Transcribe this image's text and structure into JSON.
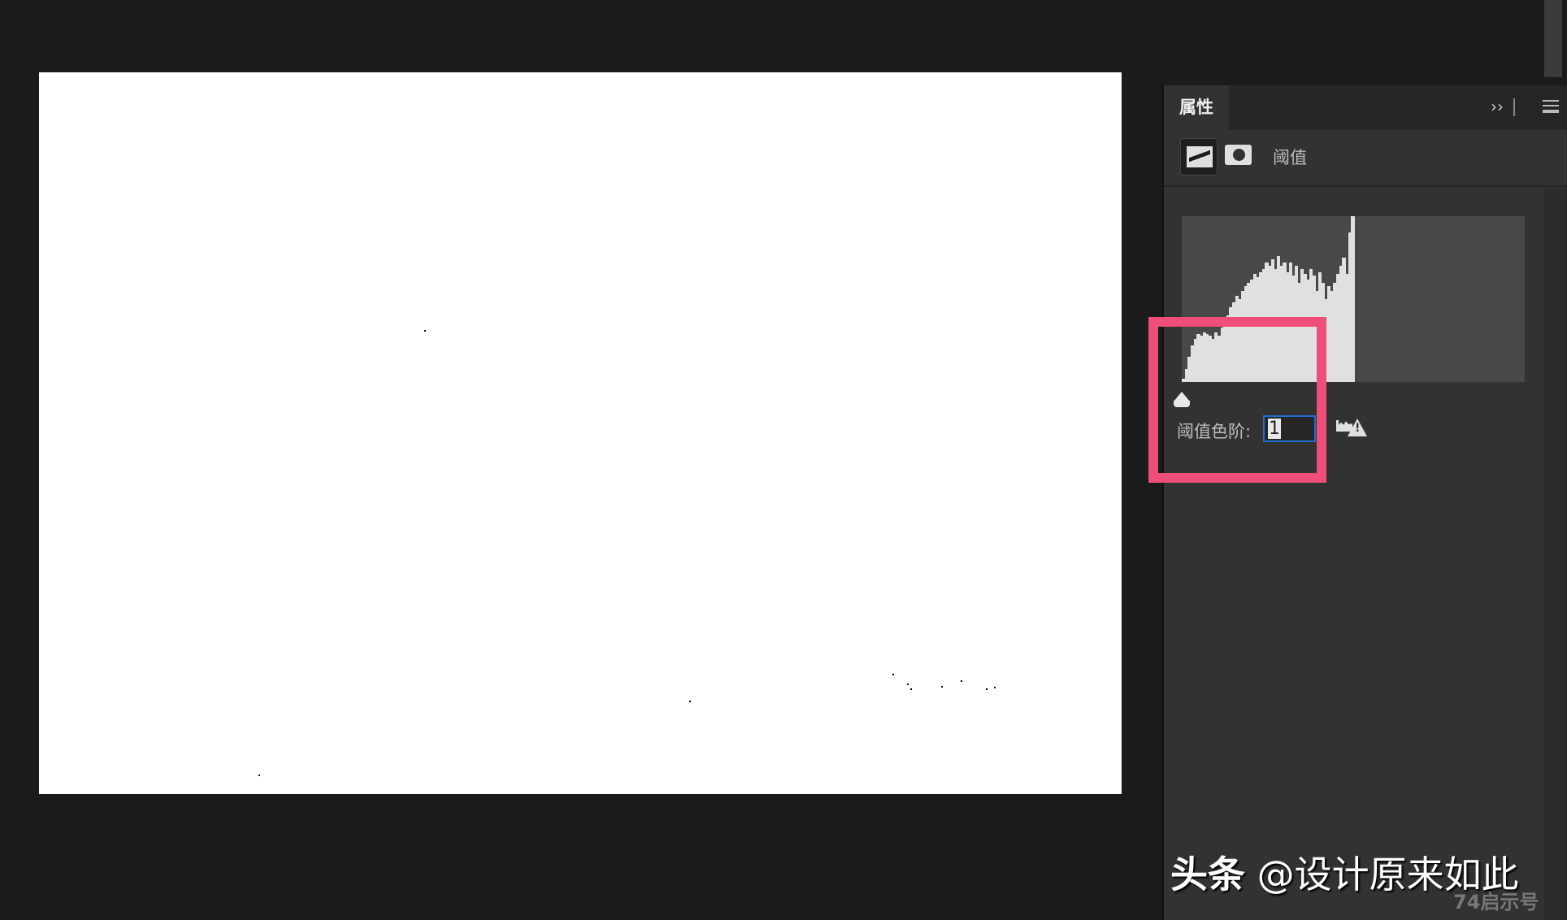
{
  "panel": {
    "tab_label": "属性",
    "collapse_icon": "double-chevron-right-icon",
    "menu_icon": "hamburger-menu-icon",
    "adjustment_name": "阈值",
    "threshold_label": "阈值色阶:",
    "threshold_value": "1"
  },
  "histogram": {
    "range": [
      0,
      255
    ],
    "levels_relative_height": [
      0.02,
      0.08,
      0.15,
      0.22,
      0.26,
      0.29,
      0.28,
      0.3,
      0.29,
      0.28,
      0.26,
      0.3,
      0.28,
      0.33,
      0.35,
      0.4,
      0.45,
      0.48,
      0.52,
      0.5,
      0.55,
      0.58,
      0.6,
      0.62,
      0.65,
      0.63,
      0.66,
      0.68,
      0.72,
      0.7,
      0.74,
      0.68,
      0.76,
      0.7,
      0.72,
      0.66,
      0.72,
      0.64,
      0.7,
      0.6,
      0.68,
      0.65,
      0.62,
      0.68,
      0.64,
      0.55,
      0.66,
      0.6,
      0.5,
      0.58,
      0.55,
      0.6,
      0.65,
      0.7,
      0.75,
      0.65,
      0.9,
      1.0
    ],
    "highlight_color": "#ef4e7b"
  },
  "watermark": {
    "brand": "头条",
    "handle": "@设计原来如此",
    "sub": "74启示号"
  }
}
